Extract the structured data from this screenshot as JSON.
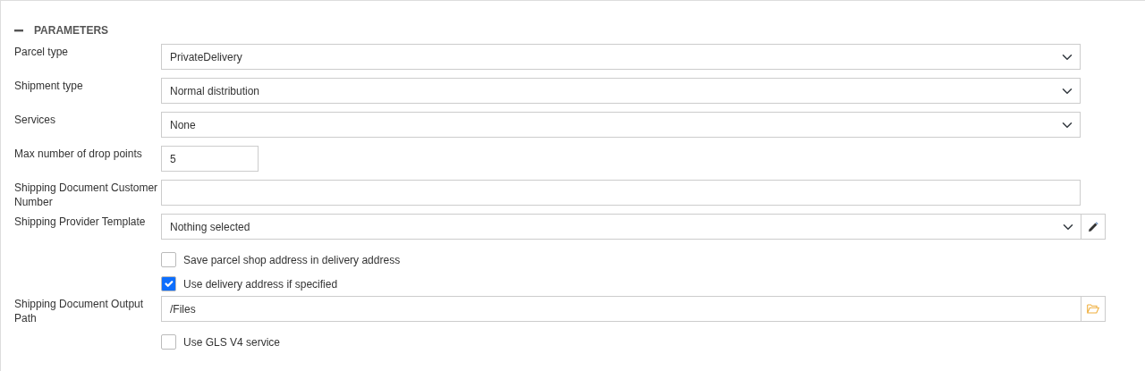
{
  "section": {
    "title": "PARAMETERS",
    "expanded": true
  },
  "rows": [
    {
      "kind": "select",
      "label": "Parcel type",
      "value": "PrivateDelivery"
    },
    {
      "kind": "select",
      "label": "Shipment type",
      "value": "Normal distribution"
    },
    {
      "kind": "select",
      "label": "Services",
      "value": "None"
    },
    {
      "kind": "short-input",
      "label": "Max number of drop points",
      "value": "5"
    },
    {
      "kind": "input",
      "label": "Shipping Document Customer Number"
    },
    {
      "kind": "select-edit",
      "label": "Shipping Provider Template",
      "value": "Nothing selected"
    },
    {
      "kind": "checkbox",
      "label": "Save parcel shop address in delivery address",
      "checked": false
    },
    {
      "kind": "checkbox",
      "label": "Use delivery address if specified",
      "checked": true
    },
    {
      "kind": "input-browse",
      "label": "Shipping Document Output Path",
      "value": "/Files"
    },
    {
      "kind": "checkbox",
      "label": "Use GLS V4 service",
      "checked": false
    }
  ]
}
